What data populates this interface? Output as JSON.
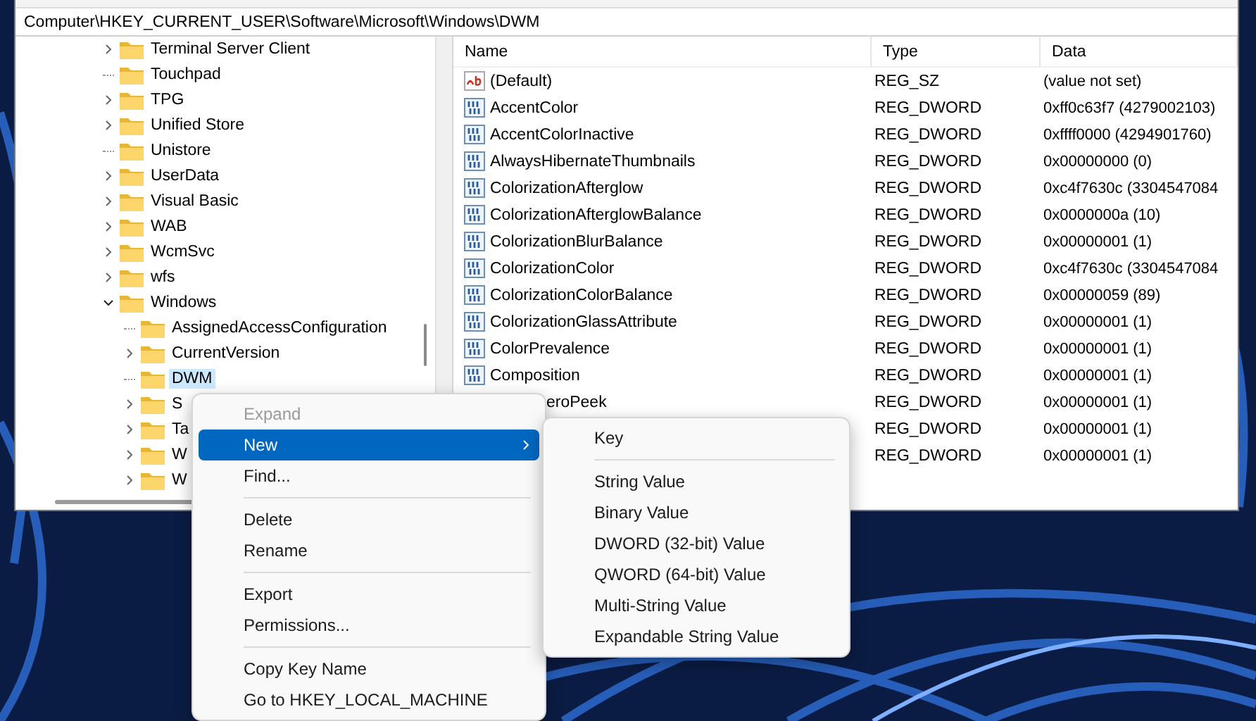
{
  "address_bar": {
    "value": "Computer\\HKEY_CURRENT_USER\\Software\\Microsoft\\Windows\\DWM"
  },
  "tree": {
    "items": [
      {
        "label": "Terminal Server Client",
        "expanded": false,
        "selected": false
      },
      {
        "label": "Touchpad",
        "selected": false
      },
      {
        "label": "TPG",
        "expanded": false,
        "selected": false
      },
      {
        "label": "Unified Store",
        "expanded": false,
        "selected": false
      },
      {
        "label": "Unistore",
        "selected": false
      },
      {
        "label": "UserData",
        "expanded": false,
        "selected": false
      },
      {
        "label": "Visual Basic",
        "expanded": false,
        "selected": false
      },
      {
        "label": "WAB",
        "expanded": false,
        "selected": false
      },
      {
        "label": "WcmSvc",
        "expanded": false,
        "selected": false
      },
      {
        "label": "wfs",
        "expanded": false,
        "selected": false
      },
      {
        "label": "Windows",
        "expanded": true,
        "selected": false,
        "children": [
          {
            "label": "AssignedAccessConfiguration",
            "selected": false
          },
          {
            "label": "CurrentVersion",
            "expanded": false,
            "selected": false
          },
          {
            "label": "DWM",
            "selected": true
          },
          {
            "label": "S",
            "expanded": false,
            "selected": false
          },
          {
            "label": "Ta",
            "expanded": false,
            "selected": false
          },
          {
            "label": "W",
            "expanded": false,
            "selected": false
          },
          {
            "label": "W",
            "expanded": false,
            "selected": false
          }
        ]
      }
    ]
  },
  "table": {
    "columns": [
      "Name",
      "Type",
      "Data"
    ],
    "rows": [
      {
        "kind": "string",
        "name": "(Default)",
        "type": "REG_SZ",
        "data": "(value not set)"
      },
      {
        "kind": "binary",
        "name": "AccentColor",
        "type": "REG_DWORD",
        "data": "0xff0c63f7 (4279002103)"
      },
      {
        "kind": "binary",
        "name": "AccentColorInactive",
        "type": "REG_DWORD",
        "data": "0xffff0000 (4294901760)"
      },
      {
        "kind": "binary",
        "name": "AlwaysHibernateThumbnails",
        "type": "REG_DWORD",
        "data": "0x00000000 (0)"
      },
      {
        "kind": "binary",
        "name": "ColorizationAfterglow",
        "type": "REG_DWORD",
        "data": "0xc4f7630c (3304547084"
      },
      {
        "kind": "binary",
        "name": "ColorizationAfterglowBalance",
        "type": "REG_DWORD",
        "data": "0x0000000a (10)"
      },
      {
        "kind": "binary",
        "name": "ColorizationBlurBalance",
        "type": "REG_DWORD",
        "data": "0x00000001 (1)"
      },
      {
        "kind": "binary",
        "name": "ColorizationColor",
        "type": "REG_DWORD",
        "data": "0xc4f7630c (3304547084"
      },
      {
        "kind": "binary",
        "name": "ColorizationColorBalance",
        "type": "REG_DWORD",
        "data": "0x00000059 (89)"
      },
      {
        "kind": "binary",
        "name": "ColorizationGlassAttribute",
        "type": "REG_DWORD",
        "data": "0x00000001 (1)"
      },
      {
        "kind": "binary",
        "name": "ColorPrevalence",
        "type": "REG_DWORD",
        "data": "0x00000001 (1)"
      },
      {
        "kind": "binary",
        "name": "Composition",
        "type": "REG_DWORD",
        "data": "0x00000001 (1)"
      },
      {
        "kind": "covered",
        "name": "eroPeek",
        "type": "REG_DWORD",
        "data": "0x00000001 (1)"
      },
      {
        "kind": "hidden",
        "type": "REG_DWORD",
        "data": "0x00000001 (1)"
      },
      {
        "kind": "hidden",
        "type": "REG_DWORD",
        "data": "0x00000001 (1)"
      }
    ]
  },
  "context_menu": {
    "items": [
      {
        "kind": "item",
        "label": "Expand",
        "disabled": true,
        "selected": false,
        "has_submenu": false
      },
      {
        "kind": "item",
        "label": "New",
        "disabled": false,
        "selected": true,
        "has_submenu": true
      },
      {
        "kind": "item",
        "label": "Find...",
        "disabled": false,
        "selected": false,
        "has_submenu": false
      },
      {
        "kind": "separator"
      },
      {
        "kind": "item",
        "label": "Delete",
        "disabled": false,
        "selected": false,
        "has_submenu": false
      },
      {
        "kind": "item",
        "label": "Rename",
        "disabled": false,
        "selected": false,
        "has_submenu": false
      },
      {
        "kind": "separator"
      },
      {
        "kind": "item",
        "label": "Export",
        "disabled": false,
        "selected": false,
        "has_submenu": false
      },
      {
        "kind": "item",
        "label": "Permissions...",
        "disabled": false,
        "selected": false,
        "has_submenu": false
      },
      {
        "kind": "separator"
      },
      {
        "kind": "item",
        "label": "Copy Key Name",
        "disabled": false,
        "selected": false,
        "has_submenu": false
      },
      {
        "kind": "item",
        "label": "Go to HKEY_LOCAL_MACHINE",
        "disabled": false,
        "selected": false,
        "has_submenu": false
      }
    ]
  },
  "submenu": {
    "items": [
      {
        "kind": "item",
        "label": "Key"
      },
      {
        "kind": "separator"
      },
      {
        "kind": "item",
        "label": "String Value"
      },
      {
        "kind": "item",
        "label": "Binary Value"
      },
      {
        "kind": "item",
        "label": "DWORD (32-bit) Value"
      },
      {
        "kind": "item",
        "label": "QWORD (64-bit) Value"
      },
      {
        "kind": "item",
        "label": "Multi-String Value"
      },
      {
        "kind": "item",
        "label": "Expandable String Value"
      }
    ]
  }
}
